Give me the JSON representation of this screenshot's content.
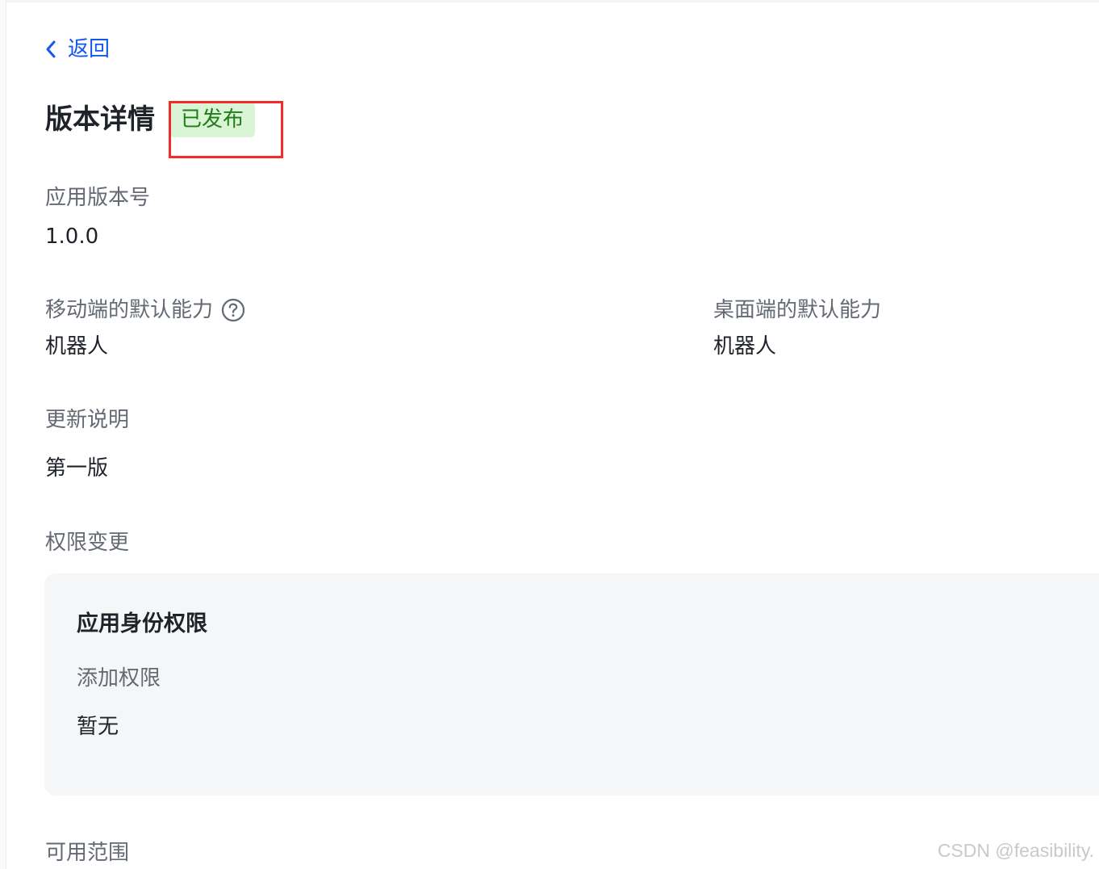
{
  "header": {
    "back_label": "返回",
    "title": "版本详情",
    "status_badge": "已发布"
  },
  "fields": {
    "version": {
      "label": "应用版本号",
      "value": "1.0.0"
    },
    "mobile_default": {
      "label": "移动端的默认能力",
      "value": "机器人"
    },
    "desktop_default": {
      "label": "桌面端的默认能力",
      "value": "机器人"
    },
    "update_notes": {
      "label": "更新说明",
      "value": "第一版"
    },
    "permission_changes": {
      "label": "权限变更"
    },
    "availability": {
      "label": "可用范围"
    }
  },
  "permissions": {
    "card_title": "应用身份权限",
    "added_label": "添加权限",
    "added_value": "暂无"
  },
  "icons": {
    "back": "chevron-left-icon",
    "help": "question-circle-icon"
  },
  "colors": {
    "link": "#1456f0",
    "badge_bg": "#d9f5d6",
    "badge_text": "#237b19",
    "highlight": "#f52a2a",
    "card_bg": "#f5f6f7"
  },
  "watermark": "CSDN @feasibility."
}
